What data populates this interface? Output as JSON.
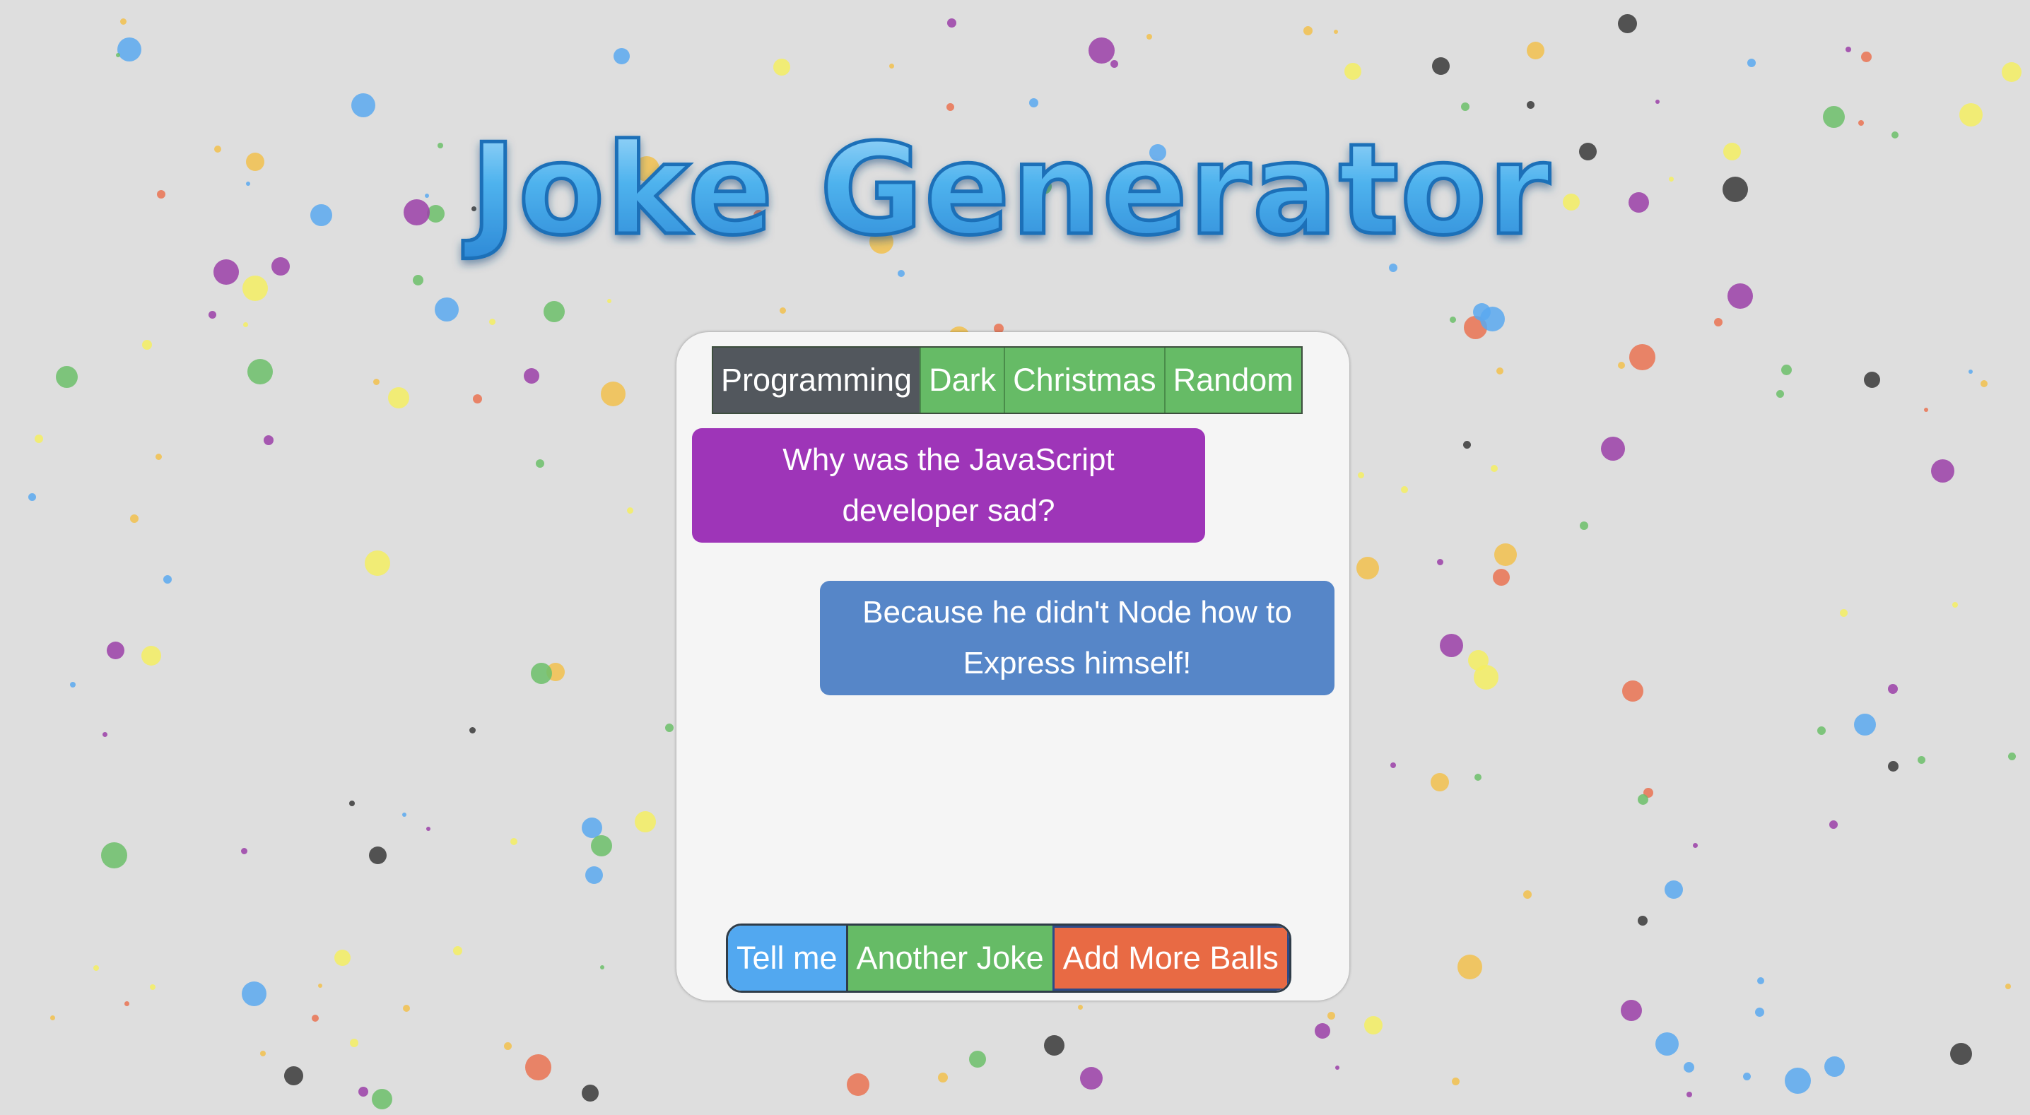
{
  "app": {
    "title": "Joke Generator"
  },
  "categories": [
    {
      "label": "Programming",
      "active": true
    },
    {
      "label": "Dark",
      "active": false
    },
    {
      "label": "Christmas",
      "active": false
    },
    {
      "label": "Random",
      "active": false
    }
  ],
  "joke": {
    "setup": "Why was the JavaScript developer sad?",
    "delivery": "Because he didn't Node how to Express himself!"
  },
  "actions": {
    "tell_me": "Tell me",
    "another_joke": "Another Joke",
    "add_more_balls": "Add More Balls"
  },
  "colors": {
    "background": "#dedede",
    "title_fill": "#4fb3ee",
    "question_bubble": "#9e35b8",
    "answer_bubble": "#5686c8",
    "tab_active": "#52575d",
    "tab_inactive": "#66bb66",
    "button_blue": "#52a8f0",
    "button_green": "#66bb66",
    "button_orange": "#e86a44",
    "ball_palette": [
      "#ea7352",
      "#9b3fa8",
      "#5aa9f0",
      "#6cc06a",
      "#3a3a3a",
      "#f2c14e",
      "#f4ef63"
    ]
  },
  "icons": {
    "decorative_balls": "bouncing-ball-icon"
  }
}
